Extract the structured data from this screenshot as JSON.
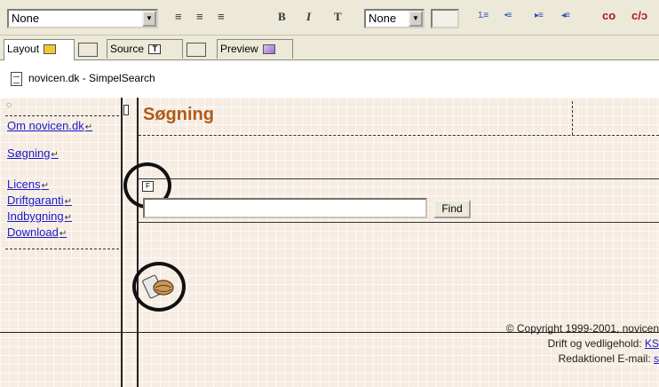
{
  "toolbar": {
    "style_select_value": "None",
    "class_select_value": "None",
    "align_left": "≡",
    "align_center": "≡",
    "align_right": "≡",
    "bold": "B",
    "italic": "I",
    "text_tool": "T",
    "ordered_list": "1.≡",
    "unordered_list": "•≡",
    "indent": "▸≡",
    "outdent": "◂≡",
    "link": "co",
    "unlink": "c/ɔ"
  },
  "tabs": [
    {
      "label": "Layout",
      "icon": "layout-icon",
      "active": true
    },
    {
      "label": "Source",
      "icon": "source-icon",
      "active": false
    },
    {
      "label": "Preview",
      "icon": "preview-icon",
      "active": false
    }
  ],
  "document": {
    "title": "novicen.dk - SimpelSearch"
  },
  "nav": {
    "items": [
      "Om novicen.dk",
      "Søgning",
      "Licens",
      "Driftgaranti",
      "Indbygning",
      "Download"
    ]
  },
  "content": {
    "heading": "Søgning",
    "form_marker": "F",
    "find_button": "Find",
    "search_value": ""
  },
  "footer": {
    "copyright": "© Copyright 1999-2001, novicen",
    "operations_label": "Drift og vedligehold: ",
    "operations_link": "KS",
    "editorial_label": "Redaktionel E-mail: ",
    "editorial_link": "s"
  },
  "colors": {
    "heading": "#b05a18",
    "link": "#1a1acc",
    "canvas": "#f6ece2"
  }
}
